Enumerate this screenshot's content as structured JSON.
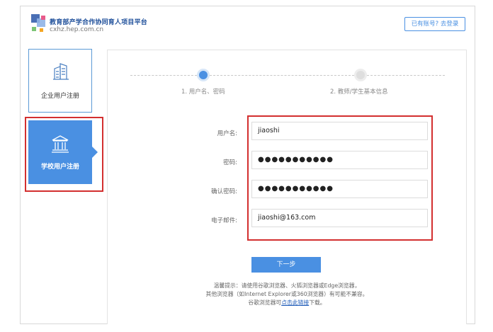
{
  "header": {
    "site_title": "教育部产学合作协同育人项目平台",
    "site_url": "cxhz.hep.com.cn",
    "login_link": "已有账号? 去登录"
  },
  "sidebar": {
    "items": [
      {
        "label": "企业用户注册",
        "icon": "building-icon",
        "active": false
      },
      {
        "label": "学校用户注册",
        "icon": "school-icon",
        "active": true
      }
    ]
  },
  "steps": [
    {
      "label": "1. 用户名、密码",
      "active": true
    },
    {
      "label": "2. 教师/学生基本信息",
      "active": false
    }
  ],
  "form": {
    "username": {
      "label": "用户名:",
      "value": "jiaoshi"
    },
    "password": {
      "label": "密码:",
      "value": "●●●●●●●●●●●"
    },
    "confirm_password": {
      "label": "确认密码:",
      "value": "●●●●●●●●●●●"
    },
    "email": {
      "label": "电子邮件:",
      "value": "jiaoshi@163.com"
    }
  },
  "next_button": "下一步",
  "tips": {
    "line1": "温馨提示：请使用谷歌浏览器、火狐浏览器或Edge浏览器，",
    "line2": "其他浏览器（如Internet Explorer或360浏览器）有可能不兼容。",
    "line3_prefix": "谷歌浏览器可",
    "line3_link": "点击此链接",
    "line3_suffix": "下载。"
  },
  "colors": {
    "accent": "#4a90e2",
    "highlight_box": "#d32f2f"
  }
}
